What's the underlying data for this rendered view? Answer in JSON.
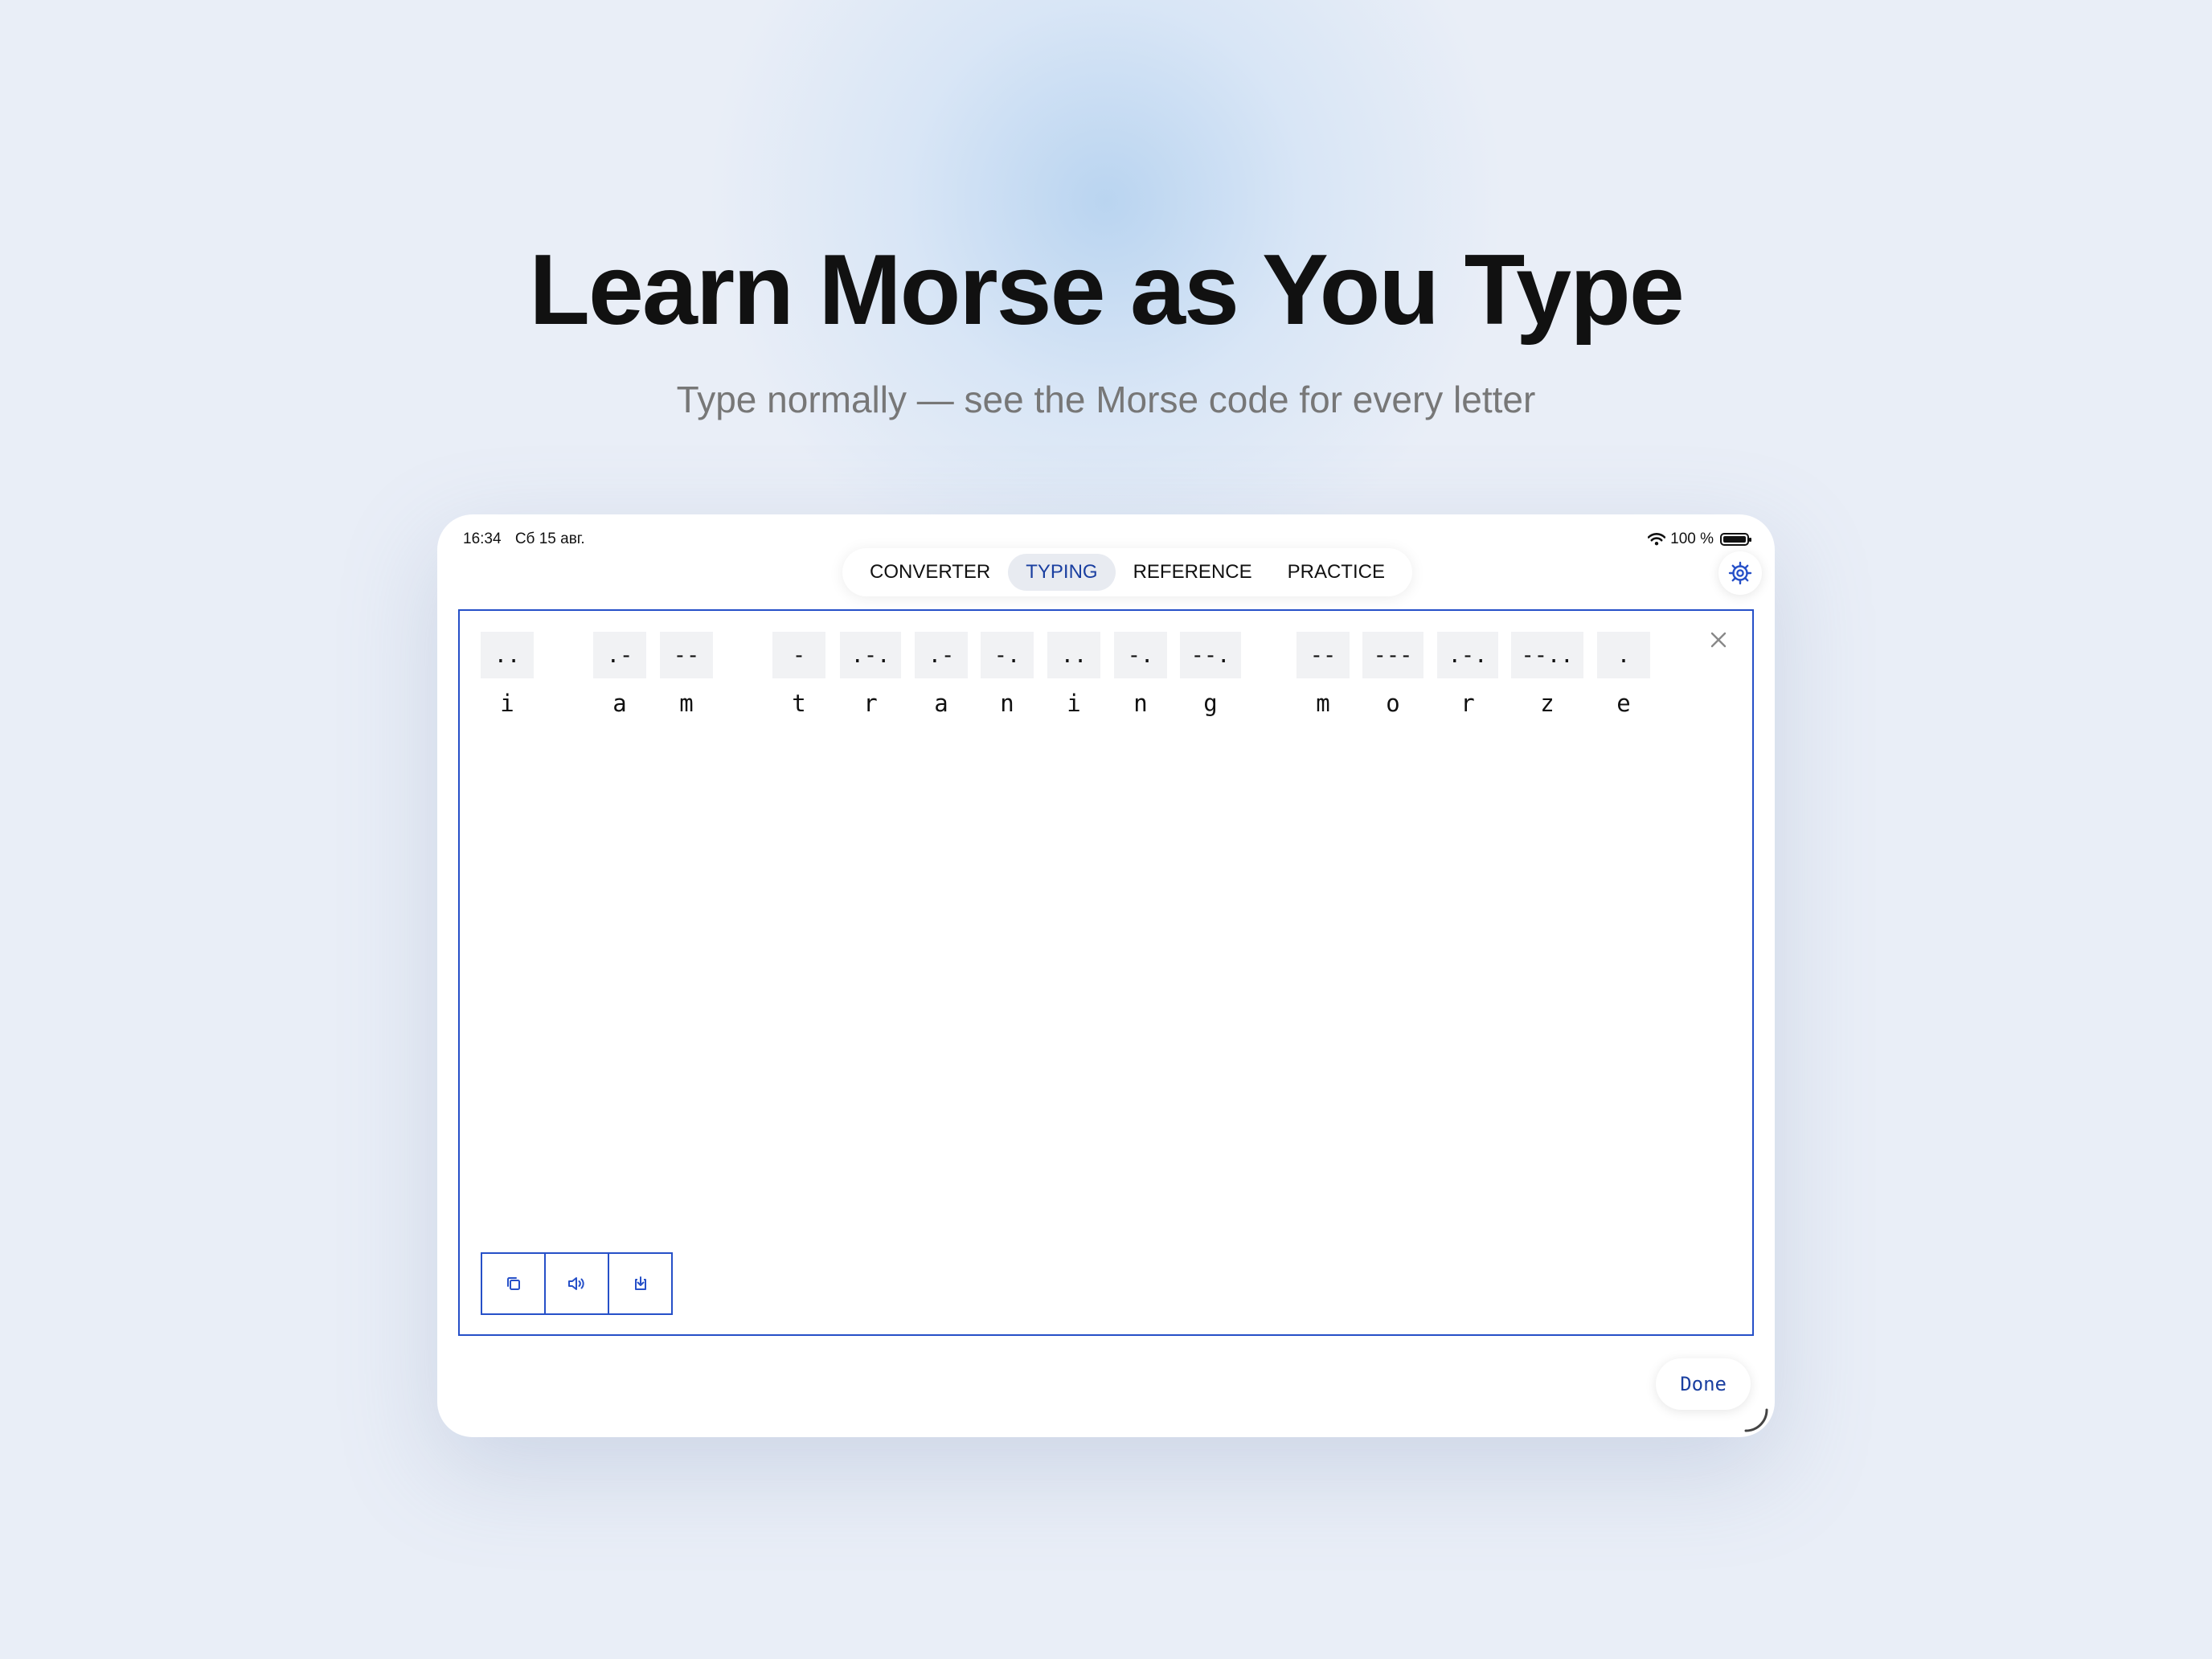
{
  "headline": "Learn Morse as You Type",
  "subtitle": "Type normally — see the Morse code for every letter",
  "statusbar": {
    "time": "16:34",
    "date": "Сб 15 авг.",
    "battery": "100 %"
  },
  "tabs": [
    {
      "label": "CONVERTER",
      "active": false
    },
    {
      "label": "TYPING",
      "active": true
    },
    {
      "label": "REFERENCE",
      "active": false
    },
    {
      "label": "PRACTICE",
      "active": false
    }
  ],
  "tokens": [
    {
      "char": "i",
      "code": ".."
    },
    {
      "char": "a",
      "code": ".-"
    },
    {
      "char": "m",
      "code": "--"
    },
    {
      "char": "t",
      "code": "-"
    },
    {
      "char": "r",
      "code": ".-."
    },
    {
      "char": "a",
      "code": ".-"
    },
    {
      "char": "n",
      "code": "-."
    },
    {
      "char": "i",
      "code": ".."
    },
    {
      "char": "n",
      "code": "-."
    },
    {
      "char": "g",
      "code": "--."
    },
    {
      "char": "m",
      "code": "--"
    },
    {
      "char": "o",
      "code": "---"
    },
    {
      "char": "r",
      "code": ".-."
    },
    {
      "char": "z",
      "code": "--.."
    },
    {
      "char": "e",
      "code": "."
    }
  ],
  "actions": [
    "copy-icon",
    "speaker-icon",
    "download-icon"
  ],
  "done_label": "Done",
  "colors": {
    "accent": "#2650c8",
    "active_tab_bg": "#e8ebf1",
    "code_bg": "#f1f2f4"
  }
}
